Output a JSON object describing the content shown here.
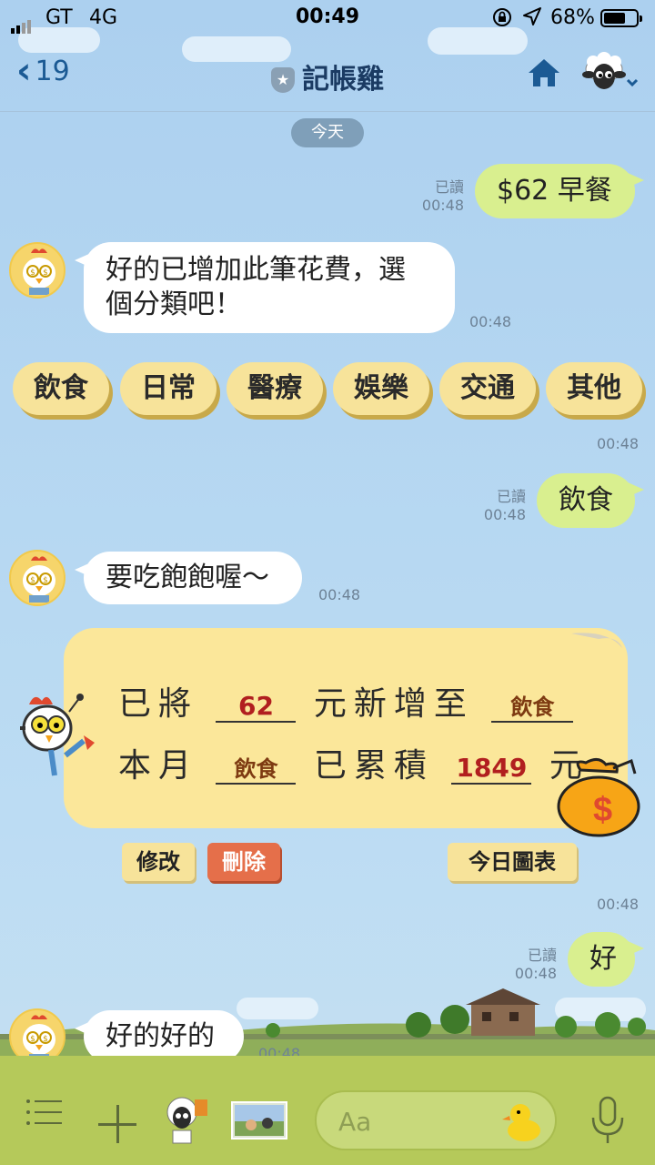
{
  "status_bar": {
    "carrier": "GT",
    "network": "4G",
    "time": "00:49",
    "battery": "68%",
    "battery_level": 0.68
  },
  "header": {
    "back_count": "19",
    "title": "記帳雞"
  },
  "date_chip": "今天",
  "messages": [
    {
      "side": "out",
      "text": "$62 早餐",
      "read": "已讀",
      "time": "00:48"
    },
    {
      "side": "in",
      "line1": "好的已增加此筆花費，選",
      "line2": "個分類吧！",
      "time": "00:48"
    },
    {
      "side": "out",
      "text": "飲食",
      "read": "已讀",
      "time": "00:48"
    },
    {
      "side": "in",
      "text": "要吃飽飽喔～",
      "time": "00:48"
    },
    {
      "side": "out",
      "text": "好",
      "read": "已讀",
      "time": "00:48"
    },
    {
      "side": "in",
      "text": "好的好的",
      "time": "00:48"
    }
  ],
  "quick_replies": {
    "items": [
      "飲食",
      "日常",
      "醫療",
      "娛樂",
      "交通",
      "其他"
    ],
    "time": "00:48"
  },
  "card": {
    "row1_a": "已將",
    "amount": "62",
    "row1_b": "元新增至",
    "category": "飲食",
    "row2_a": "本月",
    "month_category": "飲食",
    "row2_b": "已累積",
    "total": "1849",
    "row2_c": "元",
    "money_symbol": "$"
  },
  "card_actions": {
    "edit": "修改",
    "delete": "刪除",
    "chart": "今日圖表",
    "time": "00:48"
  },
  "input_bar": {
    "placeholder": "Aa"
  },
  "colors": {
    "outgoing_bubble": "#d9ef8f",
    "incoming_bubble": "#ffffff",
    "quick_reply": "#f7e39a",
    "delete_button": "#e56f4a",
    "header_text": "#1b3b63",
    "input_bar": "#b5c95a"
  },
  "icons": [
    "back-chevron-icon",
    "official-badge-icon",
    "home-icon",
    "account-sheep-icon",
    "menu-icon",
    "plus-icon",
    "sticker-icon",
    "photo-icon",
    "emoji-duck-icon",
    "microphone-icon"
  ]
}
